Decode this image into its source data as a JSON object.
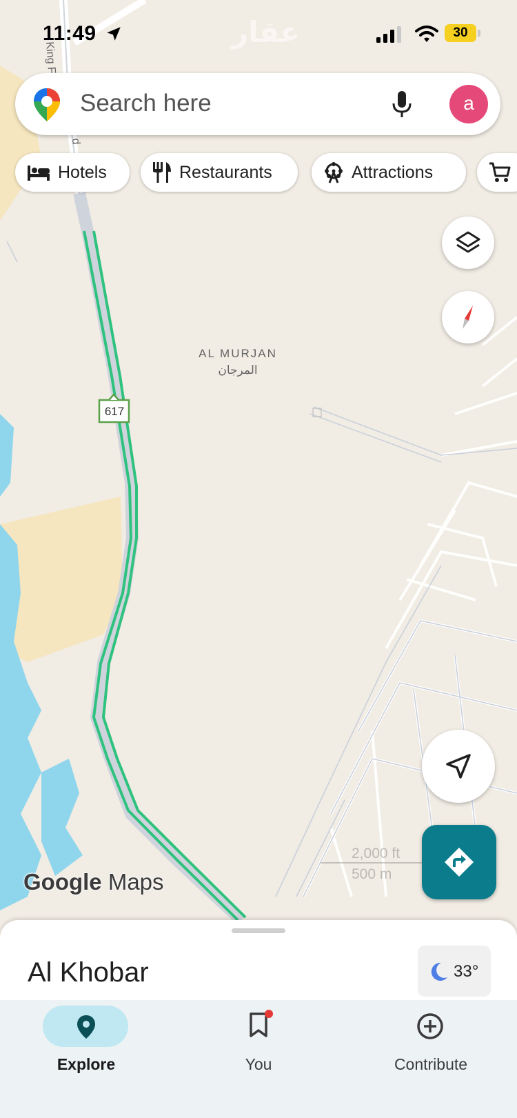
{
  "status_bar": {
    "time": "11:49",
    "battery": "30"
  },
  "watermark": "عقار",
  "search": {
    "placeholder": "Search here",
    "avatar_letter": "a"
  },
  "chips": [
    "Hotels",
    "Restaurants",
    "Attractions"
  ],
  "map": {
    "area_label_en": "AL MURJAN",
    "area_label_ar": "المرجان",
    "road_shield": "617",
    "road_name_partial": "King Fa",
    "road_name_partial_2": "d",
    "scale_ft": "2,000 ft",
    "scale_m": "500 m"
  },
  "google_logo": {
    "google": "Google",
    "maps": "Maps"
  },
  "sheet": {
    "place": "Al Khobar",
    "temperature": "33°"
  },
  "nav": {
    "explore": "Explore",
    "you": "You",
    "contribute": "Contribute"
  },
  "colors": {
    "accent": "#0b7c8c",
    "traffic": "#2ec27e",
    "water": "#8fd6ec",
    "land": "#f1ece4",
    "sand": "#f6e6bf"
  }
}
